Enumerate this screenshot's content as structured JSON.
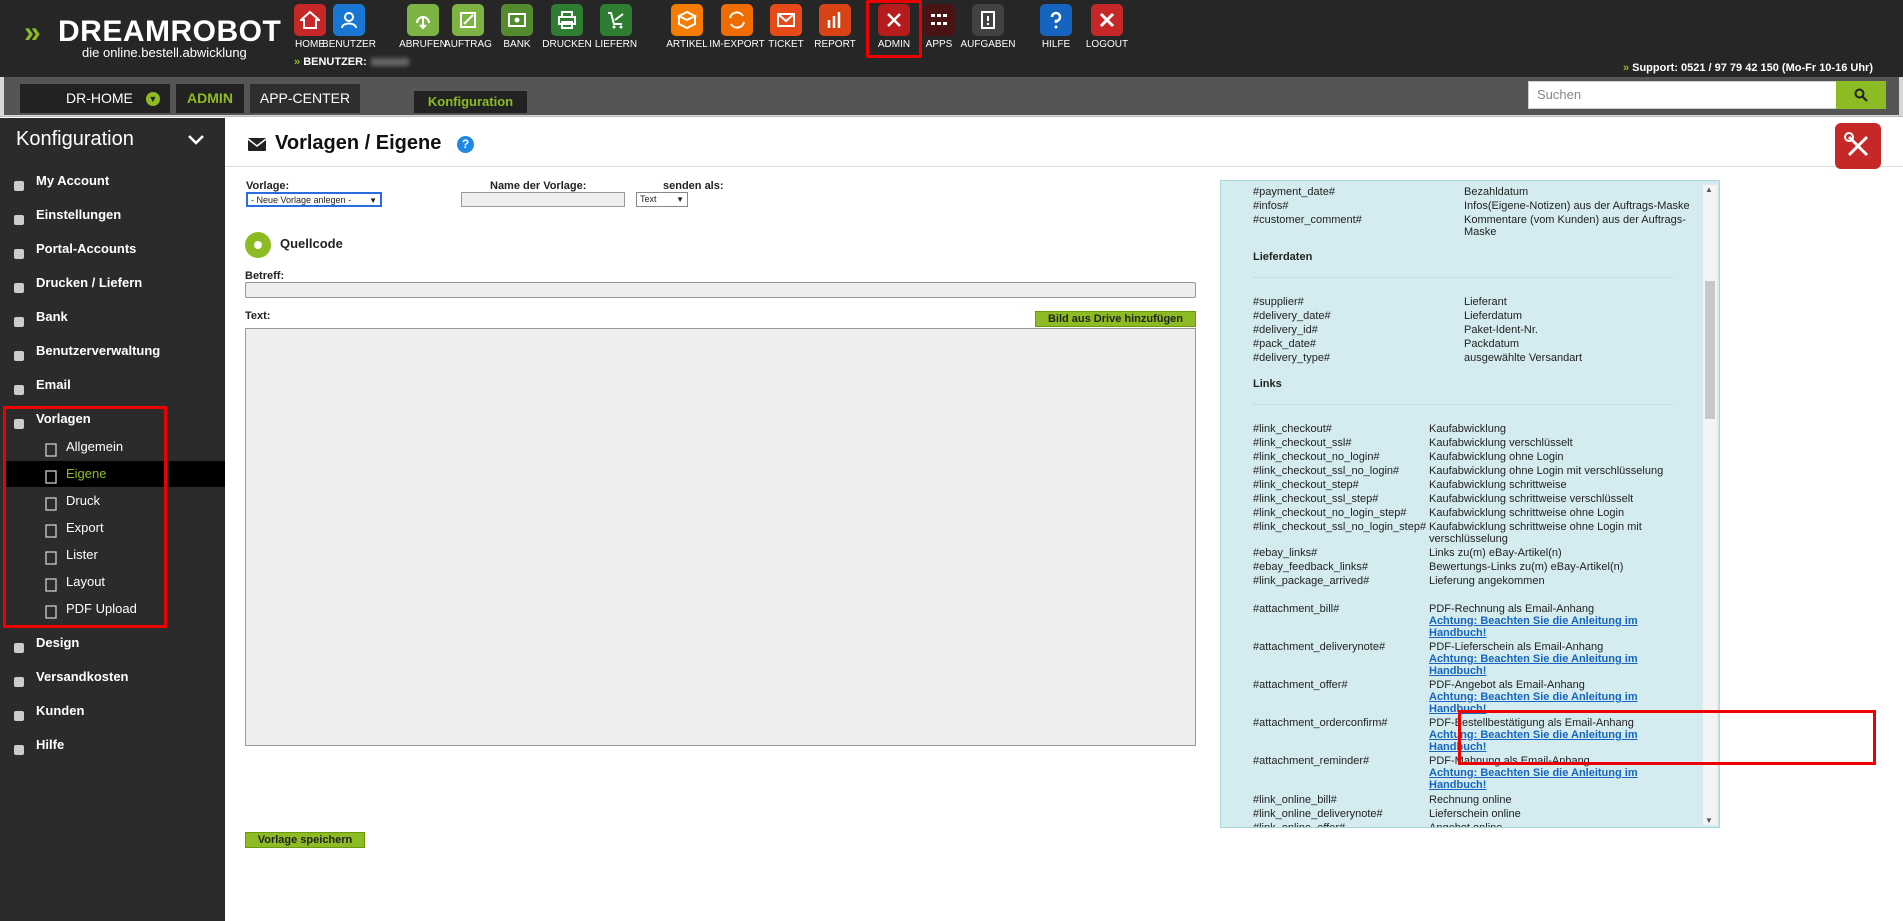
{
  "brand": {
    "logo_part1": "DREAM",
    "logo_part2": "ROBOT",
    "tagline": "die online.bestell.abwicklung"
  },
  "nav": [
    {
      "label": "HOME",
      "icon": "home-icon",
      "color": "#c62828"
    },
    {
      "label": "BENUTZER",
      "icon": "user-icon",
      "color": "#1976d2"
    },
    {
      "label": "ABRUFEN",
      "icon": "download-icon",
      "color": "#7cb342"
    },
    {
      "label": "AUFTRAG",
      "icon": "order-icon",
      "color": "#7cb342"
    },
    {
      "label": "BANK",
      "icon": "bank-icon",
      "color": "#558b2f"
    },
    {
      "label": "DRUCKEN",
      "icon": "print-icon",
      "color": "#2e7d32"
    },
    {
      "label": "LIEFERN",
      "icon": "cart-icon",
      "color": "#2e7d32"
    },
    {
      "label": "ARTIKEL",
      "icon": "box-icon",
      "color": "#f57c00"
    },
    {
      "label": "IM-EXPORT",
      "icon": "transfer-icon",
      "color": "#ef6c00"
    },
    {
      "label": "TICKET",
      "icon": "mail-icon",
      "color": "#e64a19"
    },
    {
      "label": "REPORT",
      "icon": "chart-icon",
      "color": "#d84315"
    },
    {
      "label": "ADMIN",
      "icon": "tools-icon",
      "color": "#b71c1c"
    },
    {
      "label": "APPS",
      "icon": "grid-icon",
      "color": "#4a1414"
    },
    {
      "label": "AUFGABEN",
      "icon": "task-icon",
      "color": "#424242"
    },
    {
      "label": "HILFE",
      "icon": "help-icon",
      "color": "#1565c0"
    },
    {
      "label": "LOGOUT",
      "icon": "logout-icon",
      "color": "#c62828"
    }
  ],
  "user": {
    "label": "BENUTZER:"
  },
  "support": "Support: 0521 / 97 79 42 150 (Mo-Fr 10-16 Uhr)",
  "tabs": {
    "home": "DR-HOME",
    "admin": "ADMIN",
    "appcenter": "APP-CENTER",
    "konfig": "Konfiguration"
  },
  "search": {
    "placeholder": "Suchen"
  },
  "sidebar": {
    "title": "Konfiguration",
    "items": [
      {
        "label": "My Account",
        "icon": "account-icon"
      },
      {
        "label": "Einstellungen",
        "icon": "wrench-icon"
      },
      {
        "label": "Portal-Accounts",
        "icon": "portal-icon"
      },
      {
        "label": "Drucken / Liefern",
        "icon": "printer-icon"
      },
      {
        "label": "Bank",
        "icon": "bank-icon"
      },
      {
        "label": "Benutzerverwaltung",
        "icon": "users-icon"
      },
      {
        "label": "Email",
        "icon": "envelope-icon"
      },
      {
        "label": "Vorlagen",
        "icon": "edit-icon"
      }
    ],
    "sub": [
      {
        "label": "Allgemein",
        "icon": "file-icon"
      },
      {
        "label": "Eigene",
        "icon": "envelope-icon"
      },
      {
        "label": "Druck",
        "icon": "printer-icon"
      },
      {
        "label": "Export",
        "icon": "export-icon"
      },
      {
        "label": "Lister",
        "icon": "cloud-icon"
      },
      {
        "label": "Layout",
        "icon": "table-icon"
      },
      {
        "label": "PDF Upload",
        "icon": "pdf-icon"
      }
    ],
    "after": [
      {
        "label": "Design",
        "icon": "brush-icon"
      },
      {
        "label": "Versandkosten",
        "icon": "truck-icon"
      },
      {
        "label": "Kunden",
        "icon": "person-icon"
      },
      {
        "label": "Hilfe",
        "icon": "question-icon"
      }
    ]
  },
  "page": {
    "title": "Vorlagen / Eigene",
    "help": "?"
  },
  "form": {
    "vorlage_label": "Vorlage:",
    "vorlage_value": "- Neue Vorlage anlegen -",
    "name_label": "Name der Vorlage:",
    "senden_label": "senden als:",
    "senden_value": "Text",
    "quellcode": "Quellcode",
    "betreff_label": "Betreff:",
    "text_label": "Text:",
    "drive_button": "Bild aus Drive hinzufügen",
    "save_button": "Vorlage speichern"
  },
  "placeholders": {
    "top": [
      {
        "key": "#payment_date#",
        "val": "Bezahldatum"
      },
      {
        "key": "#infos#",
        "val": "Infos(Eigene-Notizen) aus der Auftrags-Maske"
      },
      {
        "key": "#customer_comment#",
        "val": "Kommentare (vom Kunden) aus der Auftrags-",
        "val2": "Maske"
      }
    ],
    "liefer_title": "Lieferdaten",
    "liefer": [
      {
        "key": "#supplier#",
        "val": "Lieferant"
      },
      {
        "key": "#delivery_date#",
        "val": "Lieferdatum"
      },
      {
        "key": "#delivery_id#",
        "val": "Paket-Ident-Nr."
      },
      {
        "key": "#pack_date#",
        "val": "Packdatum"
      },
      {
        "key": "#delivery_type#",
        "val": "ausgewählte Versandart"
      }
    ],
    "links_title": "Links",
    "links": [
      {
        "key": "#link_checkout#",
        "val": "Kaufabwicklung"
      },
      {
        "key": "#link_checkout_ssl#",
        "val": "Kaufabwicklung verschlüsselt"
      },
      {
        "key": "#link_checkout_no_login#",
        "val": "Kaufabwicklung ohne Login"
      },
      {
        "key": "#link_checkout_ssl_no_login#",
        "val": "Kaufabwicklung ohne Login mit verschlüsselung"
      },
      {
        "key": "#link_checkout_step#",
        "val": "Kaufabwicklung schrittweise"
      },
      {
        "key": "#link_checkout_ssl_step#",
        "val": "Kaufabwicklung schrittweise verschlüsselt"
      },
      {
        "key": "#link_checkout_no_login_step#",
        "val": "Kaufabwicklung schrittweise ohne Login"
      },
      {
        "key": "#link_checkout_ssl_no_login_step#",
        "val": "Kaufabwicklung schrittweise ohne Login mit",
        "val2": "verschlüsselung"
      },
      {
        "key": "#ebay_links#",
        "val": "Links zu(m) eBay-Artikel(n)"
      },
      {
        "key": "#ebay_feedback_links#",
        "val": "Bewertungs-Links zu(m) eBay-Artikel(n)"
      },
      {
        "key": "#link_package_arrived#",
        "val": "Lieferung angekommen"
      }
    ],
    "attachments": [
      {
        "key": "#attachment_bill#",
        "val": "PDF-Rechnung als Email-Anhang"
      },
      {
        "key": "#attachment_deliverynote#",
        "val": "PDF-Lieferschein als Email-Anhang"
      },
      {
        "key": "#attachment_offer#",
        "val": "PDF-Angebot als Email-Anhang"
      },
      {
        "key": "#attachment_orderconfirm#",
        "val": "PDF-Bestellbestätigung als Email-Anhang"
      },
      {
        "key": "#attachment_reminder#",
        "val": "PDF-Mahnung als Email-Anhang"
      }
    ],
    "warn1": "Achtung: Beachten Sie die Anleitung im",
    "warn2": "Handbuch!",
    "online": [
      {
        "key": "#link_online_bill#",
        "val": "Rechnung online"
      },
      {
        "key": "#link_online_deliverynote#",
        "val": "Lieferschein online"
      },
      {
        "key": "#link_online_offer#",
        "val": "Angebot online"
      }
    ]
  }
}
